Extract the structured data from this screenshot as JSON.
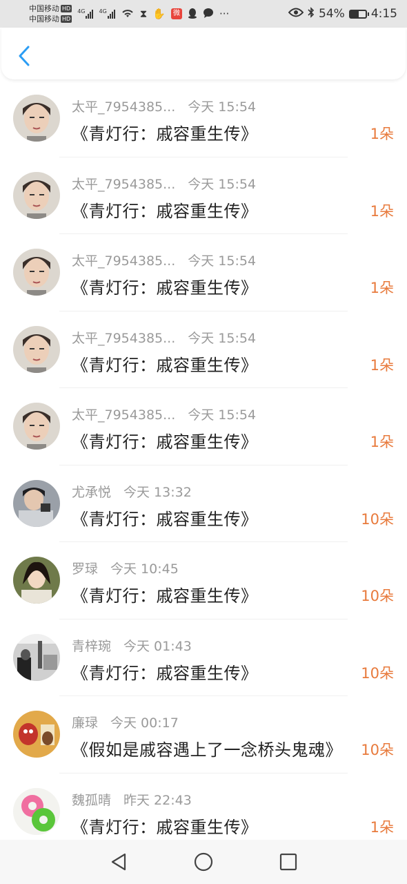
{
  "status_bar": {
    "carrier_1": "中国移动",
    "carrier_2": "中国移动",
    "hd_badge": "HD",
    "network_1": "4G",
    "network_2": "4G",
    "more": "···",
    "battery_pct": "54%",
    "battery_level": 0.54,
    "time": "4:15"
  },
  "header": {
    "back_icon": "chevron-left-icon",
    "accent_color": "#2b9df4"
  },
  "gifts": [
    {
      "user": "太平_7954385...",
      "time": "今天 15:54",
      "title": "《青灯行：戚容重生传》",
      "amount": "1朵",
      "avatar": "avatar-a"
    },
    {
      "user": "太平_7954385...",
      "time": "今天 15:54",
      "title": "《青灯行：戚容重生传》",
      "amount": "1朵",
      "avatar": "avatar-a"
    },
    {
      "user": "太平_7954385...",
      "time": "今天 15:54",
      "title": "《青灯行：戚容重生传》",
      "amount": "1朵",
      "avatar": "avatar-a"
    },
    {
      "user": "太平_7954385...",
      "time": "今天 15:54",
      "title": "《青灯行：戚容重生传》",
      "amount": "1朵",
      "avatar": "avatar-a"
    },
    {
      "user": "太平_7954385...",
      "time": "今天 15:54",
      "title": "《青灯行：戚容重生传》",
      "amount": "1朵",
      "avatar": "avatar-a"
    },
    {
      "user": "尤承悦",
      "time": "今天 13:32",
      "title": "《青灯行：戚容重生传》",
      "amount": "10朵",
      "avatar": "avatar-b"
    },
    {
      "user": "罗琭",
      "time": "今天 10:45",
      "title": "《青灯行：戚容重生传》",
      "amount": "10朵",
      "avatar": "avatar-c"
    },
    {
      "user": "青梓琬",
      "time": "今天 01:43",
      "title": "《青灯行：戚容重生传》",
      "amount": "10朵",
      "avatar": "avatar-d"
    },
    {
      "user": "廉琭",
      "time": "今天 00:17",
      "title": "《假如是戚容遇上了一念桥头鬼魂》",
      "amount": "10朵",
      "avatar": "avatar-e"
    },
    {
      "user": "魏孤晴",
      "time": "昨天 22:43",
      "title": "《青灯行：戚容重生传》",
      "amount": "1朵",
      "avatar": "avatar-f"
    }
  ],
  "colors": {
    "amount": "#e87a3c",
    "meta": "#9a9a9a",
    "title": "#222222"
  },
  "nav": {
    "back": "triangle-back-icon",
    "home": "circle-home-icon",
    "recents": "square-recents-icon"
  }
}
